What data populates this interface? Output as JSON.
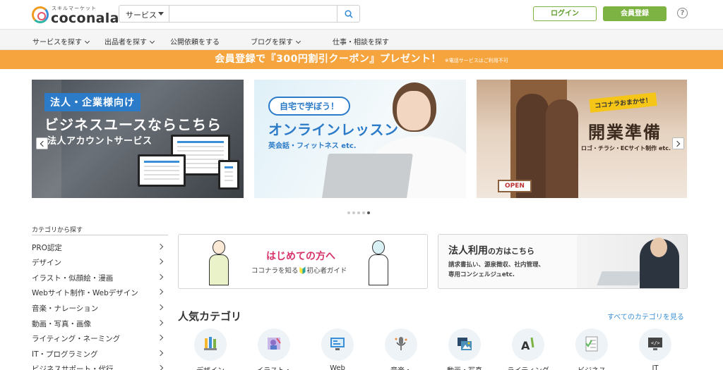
{
  "header": {
    "logo_sub": "スキルマーケット",
    "logo_text": "coconala",
    "search": {
      "category": "サービス",
      "placeholder": ""
    },
    "login_label": "ログイン",
    "register_label": "会員登録",
    "help_label": "?"
  },
  "nav": {
    "items": [
      {
        "label": "サービスを探す"
      },
      {
        "label": "出品者を探す"
      },
      {
        "label": "公開依頼をする"
      },
      {
        "label": "ブログを探す"
      },
      {
        "label": "仕事・相談を探す"
      }
    ]
  },
  "promo": {
    "main": "会員登録で『300円割引クーポン』プレゼント！",
    "note": "※電話サービスはご利用不可"
  },
  "carousel": {
    "slide1": {
      "tag": "法人・企業様向け",
      "title": "ビジネスユースならこちら",
      "subtitle": "法人アカウントサービス"
    },
    "slide2": {
      "bubble": "自宅で学ぼう！",
      "title": "オンラインレッスン",
      "subtitle": "英会話・フィットネス etc."
    },
    "slide3": {
      "badge": "ココナラおまかせ！",
      "title": "開業準備",
      "subtitle": "ロゴ・チラシ・ECサイト制作 etc.",
      "sign": "OPEN"
    },
    "dots": 5,
    "active_dot": 4
  },
  "sidebar": {
    "title": "カテゴリから探す",
    "items": [
      {
        "label": "PRO認定"
      },
      {
        "label": "デザイン"
      },
      {
        "label": "イラスト・似顔絵・漫画"
      },
      {
        "label": "Webサイト制作・Webデザイン"
      },
      {
        "label": "音楽・ナレーション"
      },
      {
        "label": "動画・写真・画像"
      },
      {
        "label": "ライティング・ネーミング"
      },
      {
        "label": "IT・プログラミング"
      },
      {
        "label": "ビジネスサポート・代行"
      }
    ]
  },
  "cards": {
    "first": {
      "title": "はじめての方へ",
      "subtitle": "ココナラを知る🔰初心者ガイド"
    },
    "business": {
      "title_main": "法人利用",
      "title_rest": "の方はこちら",
      "line1": "請求書払い、源泉徴収、社内管理、",
      "line2": "専用コンシェルジュetc."
    }
  },
  "popular": {
    "title": "人気カテゴリ",
    "see_all": "すべてのカテゴリを見る",
    "items": [
      {
        "label": "デザイン",
        "icon": "design-icon",
        "color": "#f5b82e"
      },
      {
        "label": "イラスト・",
        "icon": "illustration-icon",
        "color": "#8e6fc8"
      },
      {
        "label": "Web",
        "icon": "web-icon",
        "color": "#3a8fd6"
      },
      {
        "label": "音楽・",
        "icon": "music-icon",
        "color": "#e58a3a"
      },
      {
        "label": "動画・写真",
        "icon": "video-icon",
        "color": "#4a90b8"
      },
      {
        "label": "ライティング",
        "icon": "writing-icon",
        "color": "#7cb342"
      },
      {
        "label": "ビジネス",
        "icon": "business-icon",
        "color": "#5cb85c"
      },
      {
        "label": "IT",
        "icon": "it-icon",
        "color": "#444444"
      }
    ]
  },
  "colors": {
    "accent_green": "#7cb342",
    "promo_orange": "#f6a43d",
    "link_blue": "#3a8fd6",
    "pink": "#d6336c"
  }
}
